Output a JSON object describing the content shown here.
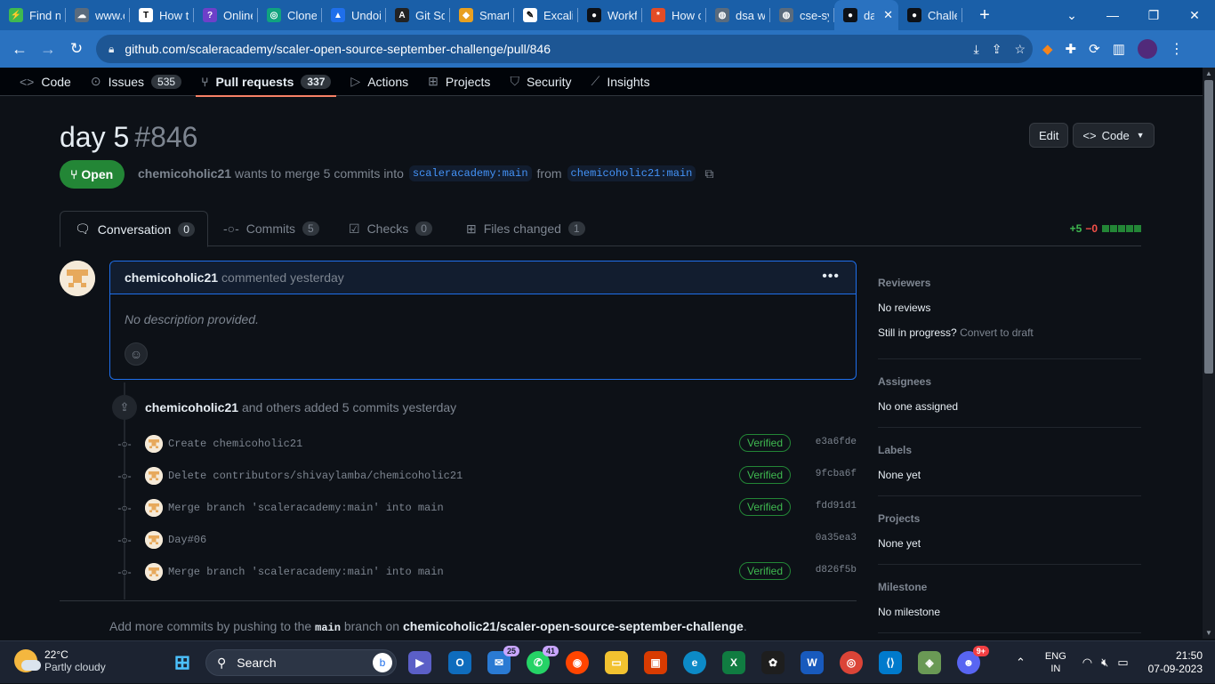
{
  "browser": {
    "tabs": [
      {
        "label": "Find n",
        "color": "#3fb950",
        "glyph": "⚡"
      },
      {
        "label": "www.c",
        "color": "#5a6b7d",
        "glyph": "☁"
      },
      {
        "label": "How t",
        "color": "#ffffff",
        "glyph": "T"
      },
      {
        "label": "Online",
        "color": "#6e40c9",
        "glyph": "?"
      },
      {
        "label": "Clone",
        "color": "#10a37f",
        "glyph": "◎"
      },
      {
        "label": "Undoi",
        "color": "#1f6feb",
        "glyph": "▲"
      },
      {
        "label": "Git Sq",
        "color": "#222222",
        "glyph": "A"
      },
      {
        "label": "Smart",
        "color": "#e8a020",
        "glyph": "◆"
      },
      {
        "label": "Excali",
        "color": "#ffffff",
        "glyph": "✎"
      },
      {
        "label": "Workf",
        "color": "#0d1117",
        "glyph": "●"
      },
      {
        "label": "How c",
        "color": "#e34c26",
        "glyph": "*"
      },
      {
        "label": "dsa w",
        "color": "#5a6b7d",
        "glyph": "◍"
      },
      {
        "label": "cse-sy",
        "color": "#5a6b7d",
        "glyph": "◍"
      },
      {
        "label": "da",
        "color": "#0d1117",
        "glyph": "●"
      },
      {
        "label": "Challe",
        "color": "#0d1117",
        "glyph": "●"
      }
    ],
    "active_tab_index": 13,
    "url": "github.com/scaleracademy/scaler-open-source-september-challenge/pull/846"
  },
  "repo_nav": {
    "code": "Code",
    "issues": "Issues",
    "issues_count": "535",
    "pulls": "Pull requests",
    "pulls_count": "337",
    "actions": "Actions",
    "projects": "Projects",
    "security": "Security",
    "insights": "Insights"
  },
  "pr": {
    "title": "day 5",
    "number": "#846",
    "edit_label": "Edit",
    "code_label": "Code",
    "state": "Open",
    "author": "chemicoholic21",
    "meta_text": "wants to merge 5 commits into",
    "base_branch": "scaleracademy:main",
    "from_text": "from",
    "head_branch": "chemicoholic21:main"
  },
  "tabs": {
    "conversation": "Conversation",
    "conversation_count": "0",
    "commits": "Commits",
    "commits_count": "5",
    "checks": "Checks",
    "checks_count": "0",
    "files": "Files changed",
    "files_count": "1",
    "additions": "+5",
    "deletions": "−0"
  },
  "comment": {
    "author": "chemicoholic21",
    "when": "commented yesterday",
    "body": "No description provided."
  },
  "timeline": {
    "author": "chemicoholic21",
    "summary": "and others added 5 commits yesterday",
    "commits": [
      {
        "message": "Create chemicoholic21",
        "verified": "Verified",
        "sha": "e3a6fde"
      },
      {
        "message": "Delete contributors/shivaylamba/chemicoholic21",
        "verified": "Verified",
        "sha": "9fcba6f"
      },
      {
        "message": "Merge branch 'scaleracademy:main' into main",
        "verified": "Verified",
        "sha": "fdd91d1"
      },
      {
        "message": "Day#06",
        "verified": "",
        "sha": "0a35ea3"
      },
      {
        "message": "Merge branch 'scaleracademy:main' into main",
        "verified": "Verified",
        "sha": "d826f5b"
      }
    ]
  },
  "footer": {
    "pre": "Add more commits by pushing to the",
    "branch": "main",
    "mid": "branch on",
    "repo": "chemicoholic21/scaler-open-source-september-challenge",
    "end": "."
  },
  "sidebar": {
    "reviewers_h": "Reviewers",
    "reviewers_v": "No reviews",
    "progress_text": "Still in progress?",
    "convert_draft": "Convert to draft",
    "assignees_h": "Assignees",
    "assignees_v": "No one assigned",
    "labels_h": "Labels",
    "labels_v": "None yet",
    "projects_h": "Projects",
    "projects_v": "None yet",
    "milestone_h": "Milestone",
    "milestone_v": "No milestone"
  },
  "taskbar": {
    "temp": "22°C",
    "weather": "Partly cloudy",
    "search": "Search",
    "badge_teams": "25",
    "badge_whatsapp": "41",
    "badge_discord": "9+",
    "lang1": "ENG",
    "lang2": "IN",
    "time": "21:50",
    "date": "07-09-2023"
  }
}
